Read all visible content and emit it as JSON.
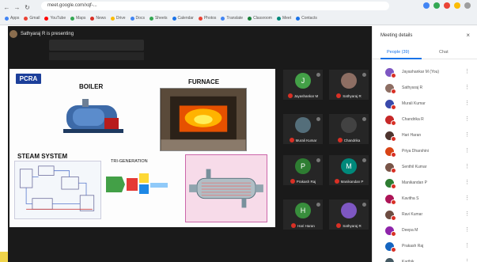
{
  "browser": {
    "url": "meet.google.com/xqf-...",
    "nav": [
      "←",
      "→",
      "↻"
    ],
    "extension_colors": [
      "#4285f4",
      "#34a853",
      "#ea4335",
      "#fbbc05",
      "#9e9e9e"
    ],
    "bookmarks": [
      {
        "label": "Apps",
        "color": "#4285f4"
      },
      {
        "label": "Gmail",
        "color": "#ea4335"
      },
      {
        "label": "YouTube",
        "color": "#ff0000"
      },
      {
        "label": "Maps",
        "color": "#34a853"
      },
      {
        "label": "News",
        "color": "#d93025"
      },
      {
        "label": "Drive",
        "color": "#fbbc05"
      },
      {
        "label": "Docs",
        "color": "#4285f4"
      },
      {
        "label": "Sheets",
        "color": "#34a853"
      },
      {
        "label": "Calendar",
        "color": "#1a73e8"
      },
      {
        "label": "Photos",
        "color": "#ea4335"
      },
      {
        "label": "Translate",
        "color": "#4285f4"
      },
      {
        "label": "Classroom",
        "color": "#188038"
      },
      {
        "label": "Meet",
        "color": "#00897b"
      },
      {
        "label": "Contacts",
        "color": "#1a73e8"
      }
    ]
  },
  "meeting": {
    "presenting_text": "Sathyaraj R is presenting"
  },
  "slide": {
    "logo": "PCRA",
    "boiler": "BOILER",
    "furnace": "FURNACE",
    "steam_system": "STEAM SYSTEM",
    "trigeneration": "TRI-GENERATION"
  },
  "tiles": [
    {
      "initial": "J",
      "color": "#43a047",
      "name": "Jayashankar M"
    },
    {
      "initial": "",
      "color": "#8d6e63",
      "name": "Sathyaraj R"
    },
    {
      "initial": "",
      "color": "#546e7a",
      "name": "Murali Kumar"
    },
    {
      "initial": "",
      "color": "#424242",
      "name": "Chandrika"
    },
    {
      "initial": "P",
      "color": "#2e7d32",
      "name": "Prakash Raj"
    },
    {
      "initial": "M",
      "color": "#00897b",
      "name": "Manikandan P"
    },
    {
      "initial": "H",
      "color": "#388e3c",
      "name": "Hari Haran"
    },
    {
      "initial": "",
      "color": "#7e57c2",
      "name": "Sathyaraj R"
    }
  ],
  "panel": {
    "title": "Meeting details",
    "close": "×",
    "tab_people": "People (39)",
    "tab_chat": "Chat",
    "participants": [
      {
        "color": "#7e57c2",
        "name": "Jayashankar M (You)"
      },
      {
        "color": "#8d6e63",
        "name": "Sathyaraj R"
      },
      {
        "color": "#3949ab",
        "name": "Murali Kumar"
      },
      {
        "color": "#c62828",
        "name": "Chandrika R"
      },
      {
        "color": "#4e342e",
        "name": "Hari Haran"
      },
      {
        "color": "#d84315",
        "name": "Priya Dharshini"
      },
      {
        "color": "#795548",
        "name": "Senthil Kumar"
      },
      {
        "color": "#2e7d32",
        "name": "Manikandan P"
      },
      {
        "color": "#ad1457",
        "name": "Kavitha S"
      },
      {
        "color": "#6d4c41",
        "name": "Ravi Kumar"
      },
      {
        "color": "#8e24aa",
        "name": "Deepa M"
      },
      {
        "color": "#1565c0",
        "name": "Prakash Raj"
      },
      {
        "color": "#455a64",
        "name": "Karthik"
      }
    ]
  }
}
